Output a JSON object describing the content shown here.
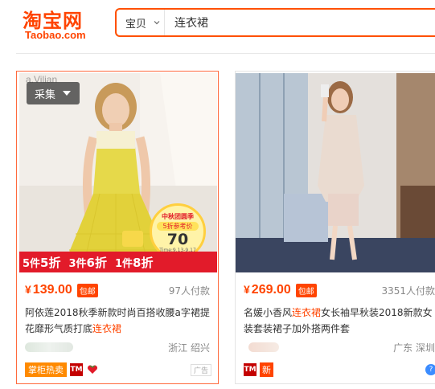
{
  "header": {
    "logo_cn": "淘宝网",
    "logo_en": "Taobao.com",
    "search_type": "宝贝",
    "search_value": "连衣裙"
  },
  "colors": {
    "brand": "#ff4400",
    "search_border": "#ff5000",
    "promo_red": "#e21b2a"
  },
  "products": [
    {
      "price_symbol": "¥",
      "price": "139.00",
      "baoyou": "包邮",
      "sales": "97人付款",
      "title_plain": "阿依莲2018秋季新款时尚百搭收腰a字裙提花靡形气质打底",
      "title_highlight": "连衣裙",
      "location": "浙江 绍兴",
      "badges": {
        "hot": "掌柜热卖",
        "tmall": "TM"
      },
      "ad": "广告",
      "collect": "采集",
      "watermark": "a.Vilian",
      "promo": {
        "p1": "5件",
        "v1": "5折",
        "p2": "3件",
        "v2": "6折",
        "p3": "1件",
        "v3": "8折"
      },
      "price_tag": {
        "line1": "中秋团圆季",
        "line2": "5折参考价",
        "value": "70",
        "time": "Time:9.13-9.17"
      }
    },
    {
      "price_symbol": "¥",
      "price": "269.00",
      "baoyou": "包邮",
      "sales": "3351人付款",
      "title_plain_1": "名媛小香风",
      "title_highlight": "连衣裙",
      "title_plain_2": "女长袖早秋装2018新款女装套装裙子加外搭两件套",
      "location": "广东 深圳",
      "badges": {
        "tmall": "TM",
        "new": "新"
      },
      "help": "?"
    }
  ]
}
